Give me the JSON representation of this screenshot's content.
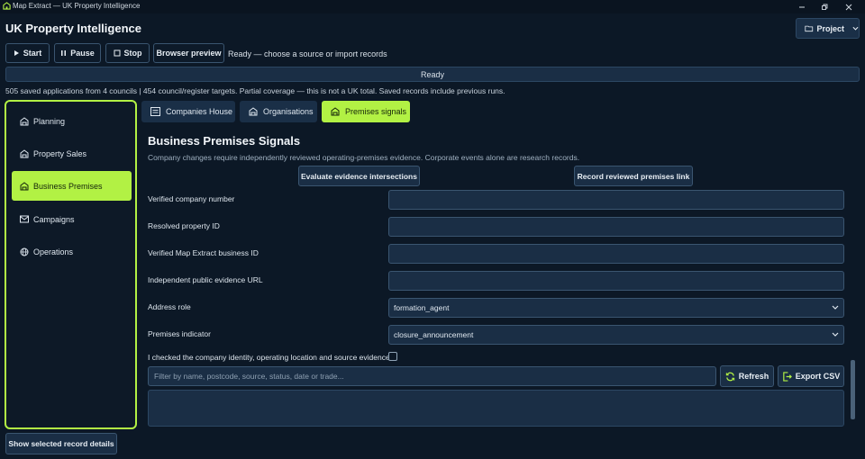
{
  "window": {
    "title": "Map Extract — UK Property Intelligence"
  },
  "app": {
    "title": "UK Property Intelligence"
  },
  "project": {
    "label": "Project"
  },
  "toolbar": {
    "start_label": "Start",
    "pause_label": "Pause",
    "stop_label": "Stop",
    "preview_label": "Browser preview",
    "status_text": "Ready — choose a source or import records"
  },
  "statusbar": {
    "text": "Ready"
  },
  "coverage": {
    "text": "505 saved applications from 4 councils | 454 council/register targets. Partial coverage — this is not a UK total. Saved records include previous runs."
  },
  "sidebar": {
    "items": [
      {
        "label": "Planning",
        "icon": "building-icon"
      },
      {
        "label": "Property Sales",
        "icon": "building-icon"
      },
      {
        "label": "Business Premises",
        "icon": "building-icon",
        "active": true
      },
      {
        "label": "Campaigns",
        "icon": "mail-icon"
      },
      {
        "label": "Operations",
        "icon": "globe-icon"
      }
    ]
  },
  "tabs": [
    {
      "label": "Companies House",
      "icon": "list-icon"
    },
    {
      "label": "Organisations",
      "icon": "building-icon"
    },
    {
      "label": "Premises signals",
      "icon": "building-icon",
      "active": true
    }
  ],
  "section": {
    "title": "Business Premises Signals",
    "subtitle": "Company changes require independently reviewed operating-premises evidence. Corporate events alone are research records.",
    "evaluate_label": "Evaluate evidence intersections",
    "record_label": "Record reviewed premises link"
  },
  "form": {
    "company_number_label": "Verified company number",
    "company_number_value": "",
    "property_id_label": "Resolved property ID",
    "property_id_value": "",
    "business_id_label": "Verified Map Extract business ID",
    "business_id_value": "",
    "evidence_url_label": "Independent public evidence URL",
    "evidence_url_value": "",
    "address_role_label": "Address role",
    "address_role_value": "formation_agent",
    "premises_indicator_label": "Premises indicator",
    "premises_indicator_value": "closure_announcement",
    "checked_label": "I checked the company identity, operating location and source evidence",
    "checked": false
  },
  "filter": {
    "placeholder": "Filter by name, postcode, source, status, date or trade...",
    "refresh_label": "Refresh",
    "export_label": "Export CSV"
  },
  "footer": {
    "details_label": "Show selected record details"
  },
  "colors": {
    "accent": "#b2f144",
    "background": "#0c1826",
    "input": "#1a2e45"
  }
}
